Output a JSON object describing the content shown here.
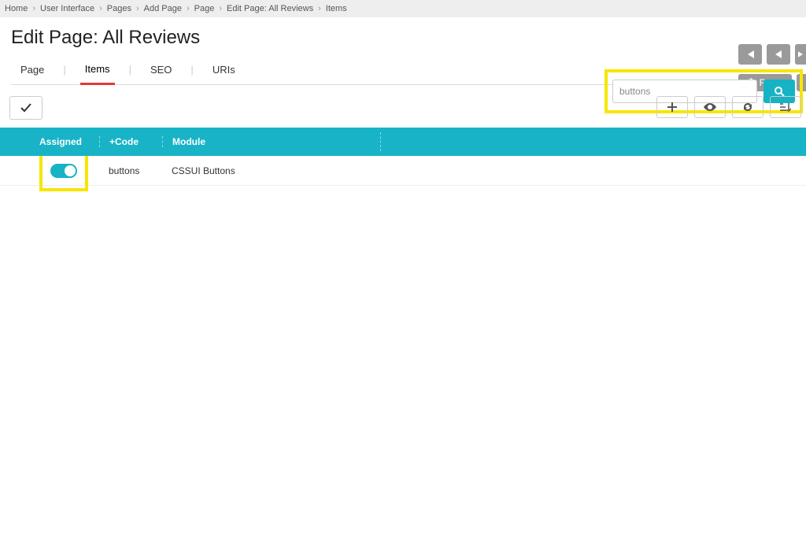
{
  "breadcrumb": [
    "Home",
    "User Interface",
    "Pages",
    "Add Page",
    "Page",
    "Edit Page: All Reviews",
    "Items"
  ],
  "title": "Edit Page: All Reviews",
  "tabs": {
    "page": "Page",
    "items": "Items",
    "seo": "SEO",
    "uris": "URIs"
  },
  "reset": "Reset",
  "search": {
    "value": "buttons"
  },
  "columns": {
    "assigned": "Assigned",
    "code": "+Code",
    "module": "Module"
  },
  "row": {
    "code": "buttons",
    "module": "CSSUI Buttons"
  }
}
